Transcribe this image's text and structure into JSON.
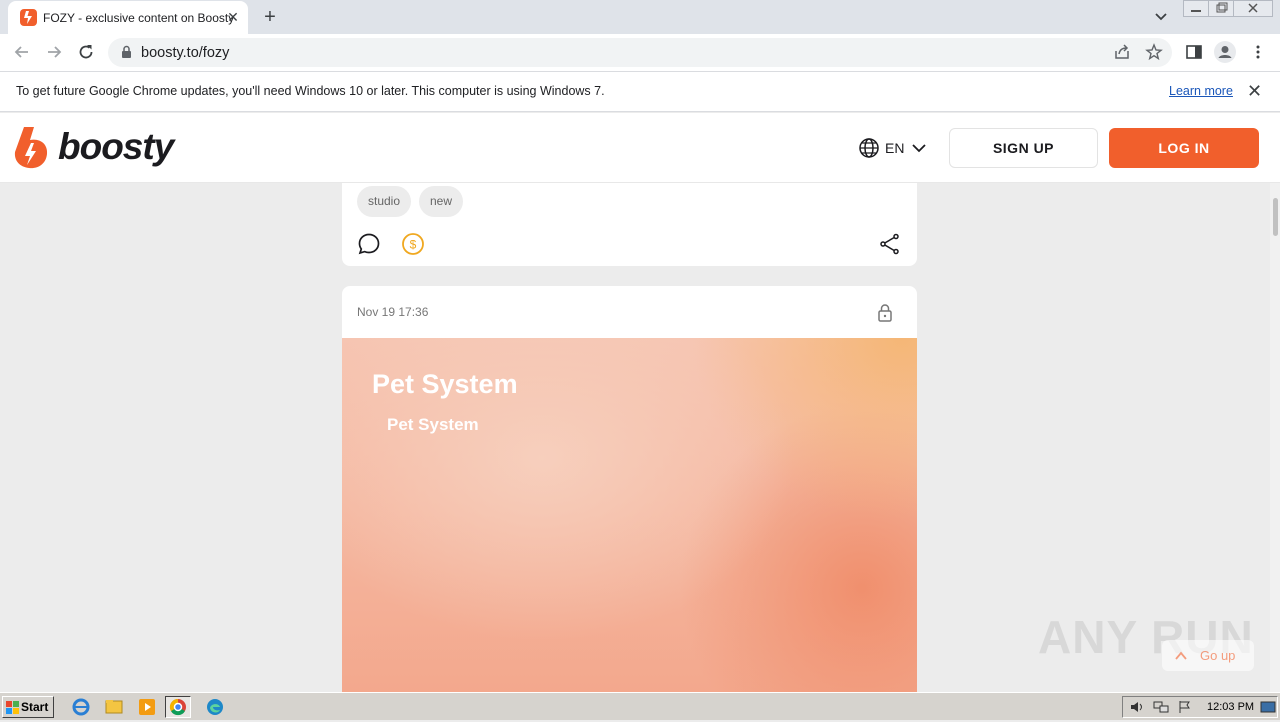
{
  "browser": {
    "tab_title": "FOZY - exclusive content on Boosty",
    "tab_close": "✕",
    "new_tab": "+",
    "url": "boosty.to/fozy"
  },
  "infobar": {
    "message": "To get future Google Chrome updates, you'll need Windows 10 or later. This computer is using Windows 7.",
    "learn_more": "Learn more",
    "close": "✕"
  },
  "header": {
    "logo_text": "boosty",
    "language": "EN",
    "sign_up": "SIGN UP",
    "log_in": "LOG IN"
  },
  "post1": {
    "tags": [
      "studio",
      "new"
    ]
  },
  "post2": {
    "date": "Nov 19 17:36",
    "cover_title": "Pet System",
    "cover_subtitle": "Pet System"
  },
  "go_up": "Go up",
  "watermark": "ANY RUN",
  "taskbar": {
    "start": "Start",
    "clock": "12:03 PM"
  },
  "colors": {
    "brand": "#f15f2c",
    "page_bg": "#ececec"
  }
}
